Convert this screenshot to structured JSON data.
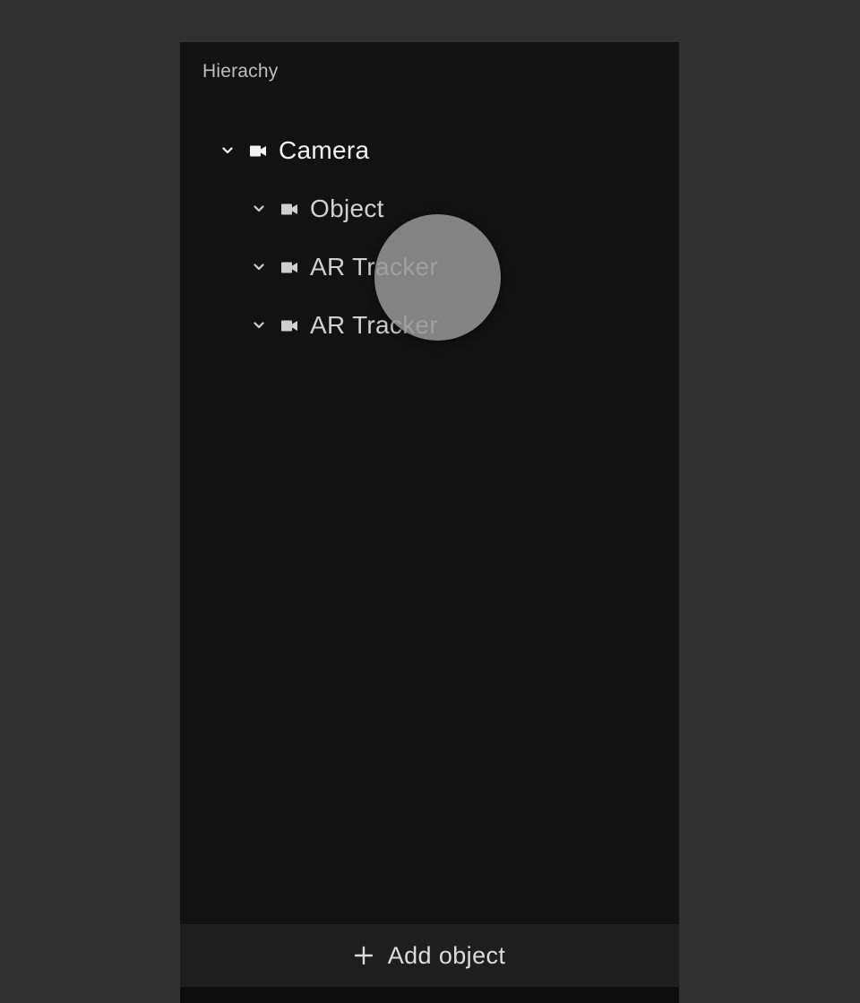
{
  "panel": {
    "title": "Hierachy"
  },
  "tree": {
    "items": [
      {
        "label": "Camera",
        "icon": "camera-icon",
        "expanded": true
      },
      {
        "label": "Object",
        "icon": "camera-icon",
        "expanded": true
      },
      {
        "label": "AR Tracker",
        "icon": "camera-icon",
        "expanded": true
      },
      {
        "label": "AR Tracker",
        "icon": "camera-icon",
        "expanded": true
      }
    ]
  },
  "footer": {
    "add_label": "Add object",
    "add_icon": "plus-icon"
  },
  "colors": {
    "background": "#303030",
    "panel": "#121212",
    "footer": "#1e1e1e",
    "text_primary": "#f2f2f2",
    "text_secondary": "#d0d0d0"
  }
}
